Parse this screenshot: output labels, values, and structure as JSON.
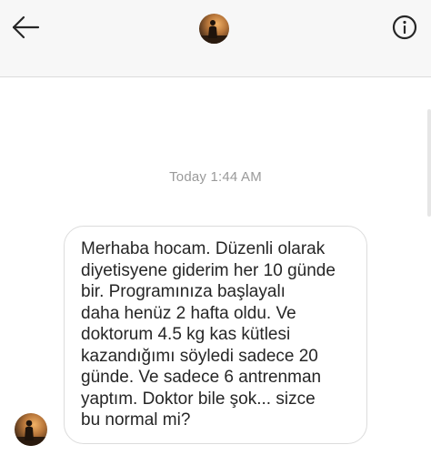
{
  "header": {
    "back_icon": "arrow-left-icon",
    "avatar_icon": "profile-photo",
    "info_icon": "info-circle-icon"
  },
  "thread": {
    "timestamp": "Today 1:44 AM",
    "message": {
      "lines": [
        "Merhaba hocam. Düzenli olarak",
        "diyetisyene giderim her 10 günde",
        "bir. Programınıza başlayalı",
        "daha henüz 2 hafta oldu. Ve",
        "doktorum 4.5 kg kas kütlesi",
        "kazandığımı söyledi sadece 20",
        "günde. Ve sadece 6 antrenman",
        "yaptım. Doktor bile şok... sizce",
        "bu normal mi?"
      ]
    }
  },
  "colors": {
    "header_bg": "#f7f7f7",
    "bubble_border": "#dcdcdc",
    "text": "#262626",
    "timestamp": "#9a9a9a"
  }
}
